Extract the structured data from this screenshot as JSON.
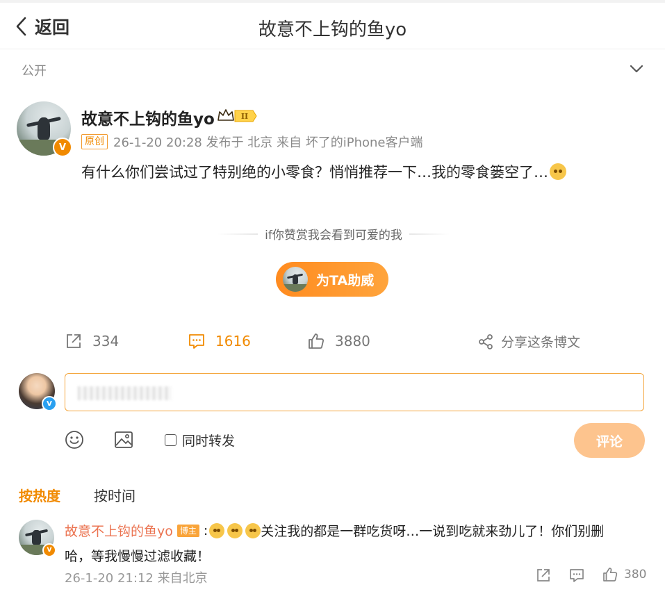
{
  "header": {
    "back_label": "返回",
    "title": "故意不上钩的鱼yo"
  },
  "visibility": {
    "label": "公开"
  },
  "post": {
    "author": "故意不上钩的鱼yo",
    "original_tag": "原创",
    "meta": "26-1-20 20:28 发布于 北京  来自 坏了的iPhone客户端",
    "text": "有什么你们尝试过了特别绝的小零食？悄悄推荐一下…我的零食篓空了…",
    "verified_badge": "V",
    "crown_level": "II"
  },
  "reward": {
    "prompt": "if你赞赏我会看到可爱的我",
    "button_label": "为TA助威"
  },
  "actions": {
    "repost_count": "334",
    "comment_count": "1616",
    "like_count": "3880",
    "share_label": "分享这条博文",
    "active_color": "#f18a00"
  },
  "composer": {
    "repost_checkbox_label": "同时转发",
    "submit_label": "评论",
    "user_badge": "V"
  },
  "sort": {
    "hot_label": "按热度",
    "time_label": "按时间"
  },
  "comments": [
    {
      "author": "故意不上钩的鱼yo",
      "host_tag": "博主",
      "separator": ":",
      "text_line1": "关注我的都是一群吃货呀…一说到吃就来劲儿了！你们别删",
      "text_line2": "哈，等我慢慢过滤收藏！",
      "meta": "26-1-20 21:12 来自北京",
      "like_count": "380",
      "badge": "V"
    }
  ],
  "icons": {
    "back": "chevron-left-icon",
    "visibility_toggle": "chevron-down-icon",
    "repost": "repost-icon",
    "comment": "comment-icon",
    "like": "thumbs-up-icon",
    "share": "share-icon",
    "emoji": "emoji-icon",
    "image": "image-icon"
  }
}
